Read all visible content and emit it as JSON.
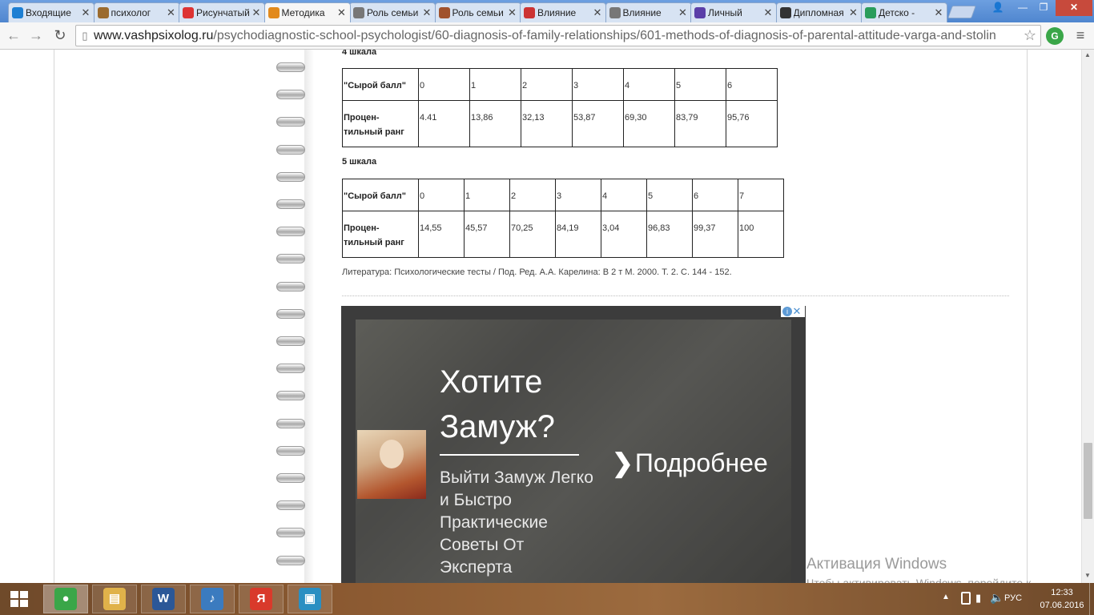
{
  "browser": {
    "tabs": [
      {
        "label": "Входящие",
        "favicon": "mail-icon",
        "color": "#1d7fd3",
        "active": false
      },
      {
        "label": "психолог",
        "favicon": "site-icon",
        "color": "#9b6b2f",
        "active": false
      },
      {
        "label": "Рисунчатый",
        "favicon": "yandex-icon",
        "color": "#d33",
        "active": false
      },
      {
        "label": "Методика",
        "favicon": "psi-icon",
        "color": "#e28a1c",
        "active": true
      },
      {
        "label": "Роль семьи",
        "favicon": "person-icon",
        "color": "#777",
        "active": false
      },
      {
        "label": "Роль семьи",
        "favicon": "bear-icon",
        "color": "#a0522d",
        "active": false
      },
      {
        "label": "Влияние",
        "favicon": "briefcase-icon",
        "color": "#c33",
        "active": false
      },
      {
        "label": "Влияние",
        "favicon": "person-icon",
        "color": "#777",
        "active": false
      },
      {
        "label": "Личный",
        "favicon": "c-icon",
        "color": "#5b3fa8",
        "active": false
      },
      {
        "label": "Дипломная",
        "favicon": "cap-icon",
        "color": "#333",
        "active": false
      },
      {
        "label": "Детско -",
        "favicon": "check-icon",
        "color": "#2a9d5c",
        "active": false
      }
    ],
    "close_glyph": "✕",
    "url_host": "www.vashpsixolog.ru",
    "url_path": "/psychodiagnostic-school-psychologist/60-diagnosis-of-family-relationships/601-methods-of-diagnosis-of-parental-attitude-varga-and-stolin"
  },
  "content": {
    "scale4": {
      "title": "4 шкала",
      "row1_label": "\"Сырой балл\"",
      "row2_label": "Процен-тильный ранг",
      "raw": [
        "0",
        "1",
        "2",
        "3",
        "4",
        "5",
        "6"
      ],
      "pct": [
        "4.41",
        "13,86",
        "32,13",
        "53,87",
        "69,30",
        "83,79",
        "95,76"
      ]
    },
    "scale5": {
      "title": "5 шкала",
      "row1_label": "\"Сырой балл\"",
      "row2_label": "Процен-тильный ранг",
      "raw": [
        "0",
        "1",
        "2",
        "3",
        "4",
        "5",
        "6",
        "7"
      ],
      "pct": [
        "14,55",
        "45,57",
        "70,25",
        "84,19",
        "3,04",
        "96,83",
        "99,37",
        "100"
      ]
    },
    "literature": "Литература: Психологические тесты / Под. Ред. А.А. Карелина: В 2 т М. 2000.   Т. 2. С. 144 - 152."
  },
  "ad": {
    "headline": "Хотите Замуж?",
    "body": "Выйти Замуж Легко и Быстро Практические Советы От Эксперта",
    "cta": "Подробнее",
    "info_glyph": "i",
    "close_glyph": "✕"
  },
  "watermark": {
    "title": "Активация Windows",
    "text": "Чтобы активировать Windows, перейдите к параметрам компьютера."
  },
  "taskbar": {
    "apps": [
      {
        "name": "chrome",
        "glyph": "●",
        "color": "#3aa648",
        "active": true
      },
      {
        "name": "explorer",
        "glyph": "▤",
        "color": "#e0b24a",
        "active": false
      },
      {
        "name": "word",
        "glyph": "W",
        "color": "#2b5797",
        "active": false
      },
      {
        "name": "media",
        "glyph": "♪",
        "color": "#3b7bbf",
        "active": false
      },
      {
        "name": "yandex",
        "glyph": "Я",
        "color": "#d93a2b",
        "active": false
      },
      {
        "name": "photos",
        "glyph": "▣",
        "color": "#2a8fc2",
        "active": false
      }
    ],
    "lang": "РУС",
    "time": "12:33",
    "date": "07.06.2016"
  }
}
